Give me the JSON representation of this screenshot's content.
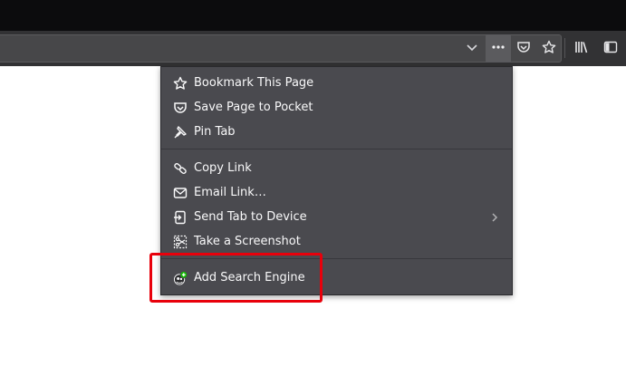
{
  "toolbar": {
    "buttons": [
      {
        "name": "url-dropdown",
        "icon": "chevron-down-icon"
      },
      {
        "name": "page-actions",
        "icon": "more-horizontal-icon"
      },
      {
        "name": "pocket",
        "icon": "pocket-icon"
      },
      {
        "name": "bookmark-star",
        "icon": "star-icon"
      },
      {
        "name": "library",
        "icon": "library-icon"
      },
      {
        "name": "sidebar",
        "icon": "sidebar-icon"
      }
    ]
  },
  "menu": {
    "items": [
      {
        "label": "Bookmark This Page",
        "icon": "star-icon"
      },
      {
        "label": "Save Page to Pocket",
        "icon": "pocket-icon"
      },
      {
        "label": "Pin Tab",
        "icon": "pin-icon"
      },
      {
        "label": "Copy Link",
        "icon": "link-icon"
      },
      {
        "label": "Email Link…",
        "icon": "email-icon"
      },
      {
        "label": "Send Tab to Device",
        "icon": "send-tab-icon",
        "has_submenu": true
      },
      {
        "label": "Take a Screenshot",
        "icon": "screenshot-icon"
      },
      {
        "label": "Add Search Engine",
        "icon": "add-search-engine-icon"
      }
    ]
  },
  "colors": {
    "menu_bg": "#4a4a4f",
    "toolbar_bg": "#323234",
    "highlight": "#e8000b"
  }
}
